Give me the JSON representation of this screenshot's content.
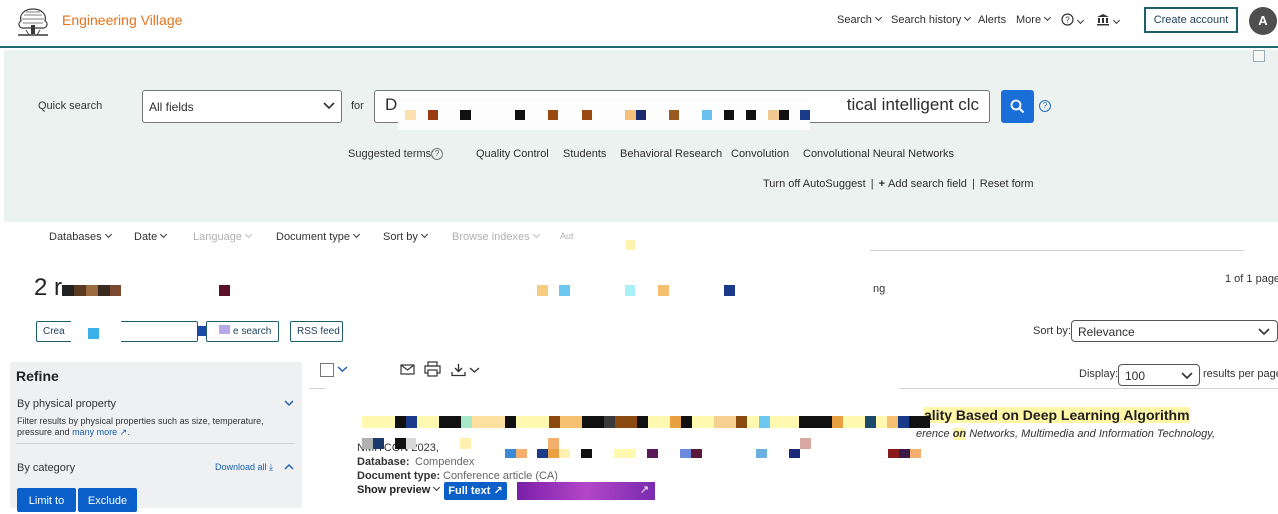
{
  "header": {
    "brand": "Engineering Village",
    "nav": {
      "search": "Search",
      "search_history": "Search history",
      "alerts": "Alerts",
      "more": "More"
    },
    "create_account": "Create account",
    "avatar_initial": "A"
  },
  "search": {
    "quick_label": "Quick search",
    "field": "All fields",
    "for_label": "for",
    "query_start": "D",
    "query_end": "tical intelligent clc",
    "suggest_label": "Suggested terms:",
    "help_glyph": "?",
    "suggested_terms": [
      "Quality Control",
      "Students",
      "Behavioral Research",
      "Convolution",
      "Convolutional Neural Networks"
    ],
    "autosuggest": "Turn off AutoSuggest",
    "add_field": "Add search field",
    "reset": "Reset form",
    "separator": "|"
  },
  "filters": {
    "databases": "Databases",
    "date": "Date",
    "language": "Language",
    "document_type": "Document type",
    "sort_by": "Sort by",
    "browse_indexes": "Browse indexes",
    "partial": "Aut"
  },
  "results": {
    "count_prefix": "2 r",
    "page_info": "1 of 1 pages",
    "partial_trailing": "ng",
    "create_alert_partial": "Crea",
    "save_search_partial": "e search",
    "rss_feed": "RSS feed",
    "sort_label": "Sort by:",
    "sort_value": "Relevance",
    "display_label": "Display:",
    "display_value": "100",
    "per_page": "results per page"
  },
  "refine": {
    "title": "Refine",
    "physical_property": "By physical property",
    "physical_desc": "Filter results by physical properties such as size, temperature, pressure and",
    "many_more": "many more",
    "category": "By category",
    "download_all": "Download all",
    "limit_to": "Limit to",
    "exclude": "Exclude"
  },
  "result_item": {
    "title_partial": "ality Based on Deep Learning Algorithm",
    "conf_prefix": "erence ",
    "conf_on": "on",
    "conf_rest": " Networks, Multimedia and Information Technology,",
    "source_partial": "NMITCON 2023,",
    "database_label": "Database:",
    "database_value": "Compendex",
    "doctype_label": "Document type:",
    "doctype_value": "Conference article (CA)",
    "show_preview": "Show preview",
    "full_text": "Full text"
  },
  "colors": {
    "brand_orange": "#e9711c",
    "panel_bg": "#ebf2ef",
    "primary_blue": "#0a5fc8",
    "teal_border": "#1c5f6b",
    "highlight": "#fff6a8"
  }
}
